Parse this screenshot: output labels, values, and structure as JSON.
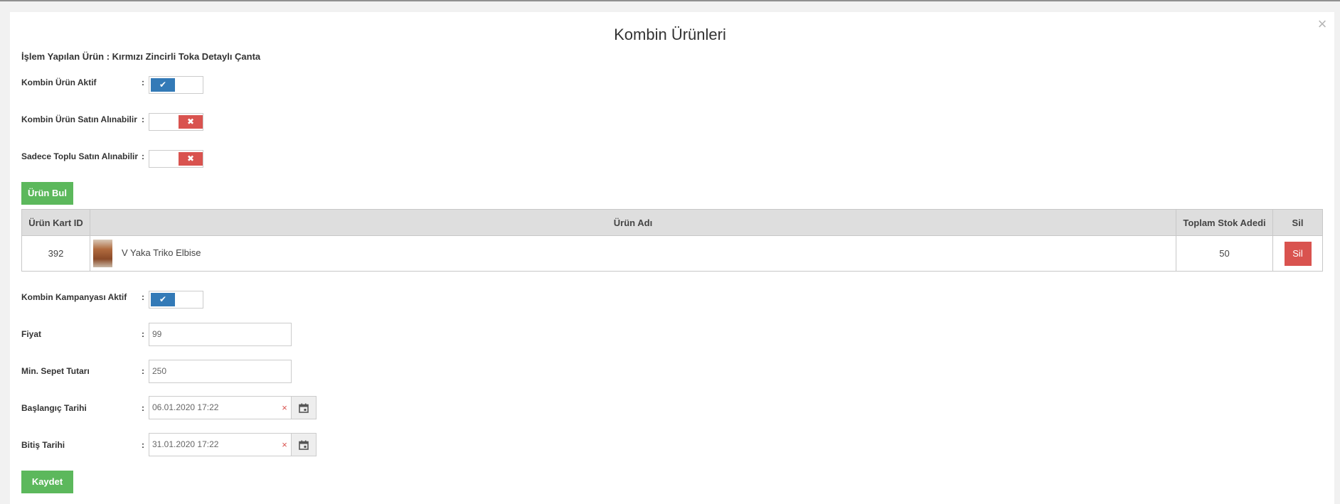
{
  "modal": {
    "title": "Kombin Ürünleri",
    "close_label": "×",
    "subject": "İşlem Yapılan Ürün : Kırmızı Zincirli Toka Detaylı Çanta"
  },
  "toggles": {
    "kombin_urun_aktif": {
      "label": "Kombin Ürün Aktif",
      "state": true
    },
    "kombin_urun_satin_alinabilir": {
      "label": "Kombin Ürün Satın Alınabilir",
      "state": false
    },
    "sadece_toplu_satin_alinabilir": {
      "label": "Sadece Toplu Satın Alınabilir",
      "state": false
    },
    "kombin_kampanyasi_aktif": {
      "label": "Kombin Kampanyası Aktif",
      "state": true
    },
    "on_glyph": "✔",
    "off_glyph": "✖"
  },
  "colon": ":",
  "find_button_label": "Ürün Bul",
  "table": {
    "headers": [
      "Ürün Kart ID",
      "Ürün Adı",
      "Toplam Stok Adedi",
      "Sil"
    ],
    "rows": [
      {
        "id": "392",
        "name": "V Yaka Triko Elbise",
        "stock": "50",
        "delete_label": "Sil"
      }
    ]
  },
  "form": {
    "fiyat": {
      "label": "Fiyat",
      "value": "99"
    },
    "min_sepet": {
      "label": "Min. Sepet Tutarı",
      "value": "250"
    },
    "baslangic": {
      "label": "Başlangıç Tarihi",
      "value": "06.01.2020 17:22"
    },
    "bitis": {
      "label": "Bitiş Tarihi",
      "value": "31.01.2020 17:22"
    },
    "clear_glyph": "×"
  },
  "save_button_label": "Kaydet",
  "colors": {
    "green": "#5cb85c",
    "blue": "#337ab7",
    "red": "#d9534f"
  }
}
